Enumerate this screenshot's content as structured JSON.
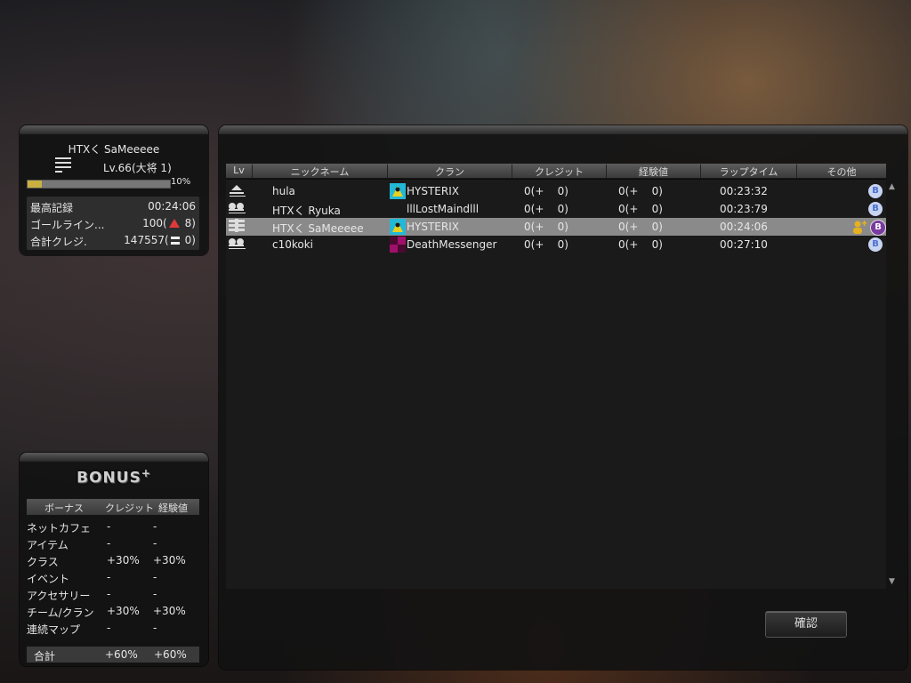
{
  "player": {
    "name": "HTXく SaMeeeee",
    "level": "Lv.66(大将 1)",
    "xp_percent_label": "10%",
    "xp_fraction": 0.1,
    "stats": [
      {
        "label": "最高記録",
        "value": "00:24:06",
        "indicator": "none"
      },
      {
        "label": "ゴールライン...",
        "value": "100(",
        "indicator": "up-triangle",
        "change": "8)"
      },
      {
        "label": "合計クレジ.",
        "value": "147557(",
        "indicator": "equal",
        "change": "0)"
      }
    ]
  },
  "bonus": {
    "title": "BONUS",
    "title_plus": "+",
    "headers": [
      "ボーナス",
      "クレジット",
      "経験値"
    ],
    "rows": [
      {
        "label": "ネットカフェ",
        "credit": "-",
        "exp": "-"
      },
      {
        "label": "アイテム",
        "credit": "-",
        "exp": "-"
      },
      {
        "label": "クラス",
        "credit": "+30%",
        "exp": "+30%"
      },
      {
        "label": "イベント",
        "credit": "-",
        "exp": "-"
      },
      {
        "label": "アクセサリー",
        "credit": "-",
        "exp": "-"
      },
      {
        "label": "チーム/クラン",
        "credit": "+30%",
        "exp": "+30%"
      },
      {
        "label": "連続マップ",
        "credit": "-",
        "exp": "-"
      }
    ],
    "total": {
      "label": "合計",
      "credit": "+60%",
      "exp": "+60%"
    }
  },
  "results": {
    "headers": [
      "Lv",
      "ニックネーム",
      "クラン",
      "クレジット",
      "経験値",
      "ラップタイム",
      "その他"
    ],
    "rows": [
      {
        "rank_icon": "rank-low-icon",
        "nickname": "hula",
        "clan_icon": "hysterix-clan-icon",
        "clan": "HYSTERIX",
        "credit": "0(+    0)",
        "exp": "0(+    0)",
        "lap": "00:23:32",
        "highlight": false,
        "extra": [
          "b-badge-icon"
        ]
      },
      {
        "rank_icon": "rank-mid-icon",
        "nickname": "HTXく Ryuka",
        "clan_icon": "",
        "clan": "lllLostMaindlll",
        "credit": "0(+    0)",
        "exp": "0(+    0)",
        "lap": "00:23:79",
        "highlight": false,
        "extra": [
          "b-badge-icon"
        ]
      },
      {
        "rank_icon": "rank-high-icon",
        "nickname": "HTXく SaMeeeee",
        "clan_icon": "hysterix-clan-icon",
        "clan": "HYSTERIX",
        "credit": "0(+    0)",
        "exp": "0(+    0)",
        "lap": "00:24:06",
        "highlight": true,
        "extra": [
          "add-friend-icon",
          "b-circle-icon"
        ]
      },
      {
        "rank_icon": "rank-mid-icon",
        "nickname": "c10koki",
        "clan_icon": "deathmessenger-clan-icon",
        "clan": "DeathMessenger",
        "credit": "0(+    0)",
        "exp": "0(+    0)",
        "lap": "00:27:10",
        "highlight": false,
        "extra": [
          "b-badge-icon"
        ]
      }
    ]
  },
  "confirm_label": "確認",
  "colors": {
    "highlight_row": "#8a8a8a",
    "xp_fill": "#c9b040",
    "up_arrow": "#e0393b",
    "badge_blue": "#4a6fd0",
    "badge_purple": "#7a3aa0"
  }
}
